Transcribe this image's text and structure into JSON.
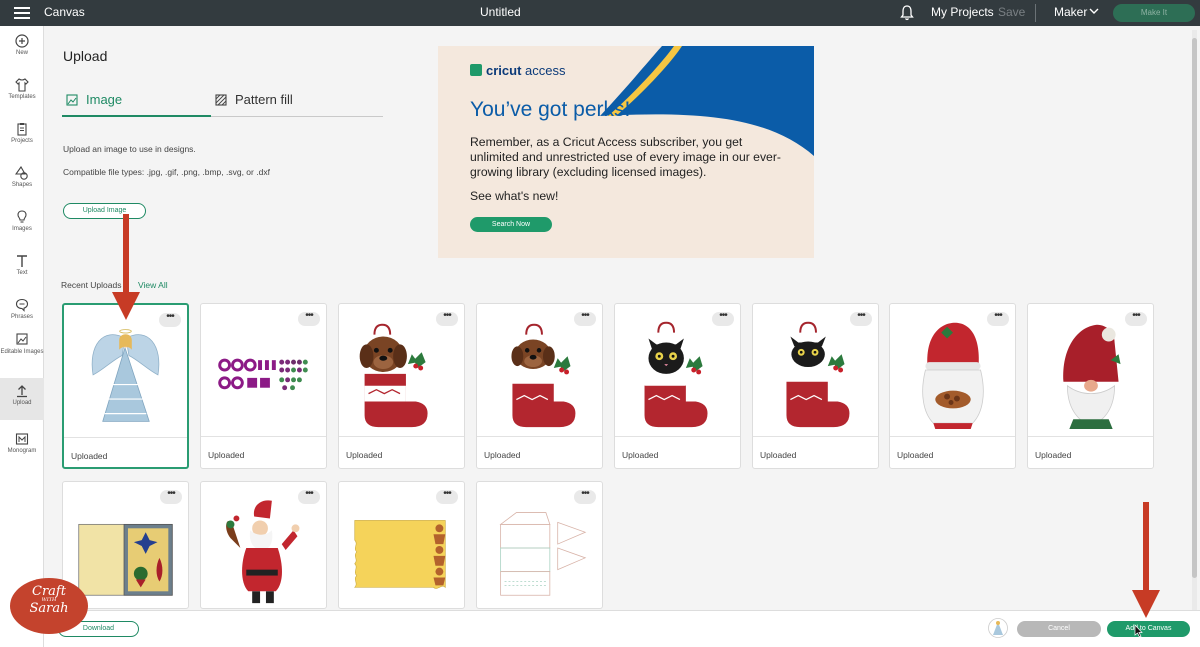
{
  "topbar": {
    "app_title": "Canvas",
    "doc_title": "Untitled",
    "my_projects": "My Projects",
    "save": "Save",
    "machine": "Maker",
    "make_it": "Make It"
  },
  "sidebar": {
    "items": [
      {
        "label": "New",
        "icon": "plus-circle-icon"
      },
      {
        "label": "Templates",
        "icon": "shirt-icon"
      },
      {
        "label": "Projects",
        "icon": "clipboard-icon"
      },
      {
        "label": "Shapes",
        "icon": "shapes-icon"
      },
      {
        "label": "Images",
        "icon": "lightbulb-icon"
      },
      {
        "label": "Text",
        "icon": "text-icon"
      },
      {
        "label": "Phrases",
        "icon": "speech-bubble-icon"
      },
      {
        "label": "Editable Images",
        "icon": "editable-image-icon"
      },
      {
        "label": "Upload",
        "icon": "upload-icon"
      },
      {
        "label": "Monogram",
        "icon": "monogram-icon"
      }
    ]
  },
  "upload_panel": {
    "heading": "Upload",
    "tabs": [
      {
        "label": "Image",
        "active": true
      },
      {
        "label": "Pattern fill",
        "active": false
      }
    ],
    "description": "Upload an image to use in designs.",
    "file_types": "Compatible file types: .jpg, .gif, .png, .bmp, .svg, or .dxf",
    "upload_button": "Upload Image"
  },
  "banner": {
    "logo_brand": "cricut",
    "logo_product": "access",
    "headline": "You’ve got perks!",
    "body": "Remember, as a Cricut Access subscriber, you get unlimited and unrestricted use of every image in our ever-growing library (excluding licensed images).",
    "cta": "See what's new!",
    "button": "Search Now",
    "colors": {
      "navy": "#0b3a79",
      "blue": "#0b5ca8",
      "green": "#1f9a6a",
      "cream": "#f4e8dd"
    }
  },
  "recent": {
    "label": "Recent Uploads",
    "view_all": "View All",
    "items": [
      {
        "subject": "angel",
        "caption": "Uploaded",
        "selected": true
      },
      {
        "subject": "purple-cut-pieces",
        "caption": "Uploaded",
        "selected": false
      },
      {
        "subject": "puppy-in-stocking",
        "caption": "Uploaded",
        "selected": false
      },
      {
        "subject": "puppy-in-stocking",
        "caption": "Uploaded",
        "selected": false
      },
      {
        "subject": "black-cat-in-stocking",
        "caption": "Uploaded",
        "selected": false
      },
      {
        "subject": "black-cat-in-stocking",
        "caption": "Uploaded",
        "selected": false
      },
      {
        "subject": "gnome-with-cookies",
        "caption": "Uploaded",
        "selected": false
      },
      {
        "subject": "gnome-red-hat",
        "caption": "Uploaded",
        "selected": false
      },
      {
        "subject": "ornament-card",
        "caption": "",
        "selected": false
      },
      {
        "subject": "santa",
        "caption": "",
        "selected": false
      },
      {
        "subject": "gingerbread-card",
        "caption": "",
        "selected": false
      },
      {
        "subject": "box-template",
        "caption": "",
        "selected": false
      }
    ]
  },
  "bottom": {
    "download": "Download",
    "cancel": "Cancel",
    "add_to_canvas": "Add to Canvas"
  },
  "watermark": {
    "line1": "Craft",
    "small": "WITH",
    "line2": "Sarah"
  },
  "colors": {
    "accent": "#1f8a64",
    "topbar": "#333b3f",
    "annotation_arrow": "#c73b25"
  }
}
